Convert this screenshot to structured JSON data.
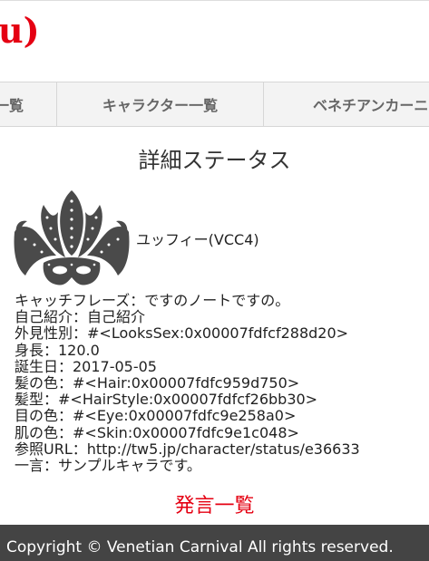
{
  "header": {
    "brand_fragment": "u)"
  },
  "nav": {
    "items": [
      {
        "label": "一覧"
      },
      {
        "label": "キャラクター一覧"
      },
      {
        "label": "ベネチアンカーニ"
      }
    ]
  },
  "page": {
    "title": "詳細ステータス"
  },
  "character": {
    "avatar_icon": "venetian-mask-icon",
    "name": "ユッフィー(VCC4)",
    "profile": [
      "キャッチフレーズ：ですのノートですの。",
      "自己紹介：自己紹介",
      "外見性別：#<LooksSex:0x00007fdfcf288d20>",
      "身長：120.0",
      "誕生日：2017-05-05",
      "髪の色：#<Hair:0x00007fdfc959d750>",
      "髪型：#<HairStyle:0x00007fdfcf26bb30>",
      "目の色：#<Eye:0x00007fdfc9e258a0>",
      "肌の色：#<Skin:0x00007fdfc9e1c048>",
      "参照URL：http://tw5.jp/character/status/e36633",
      "一言：サンプルキャラです。"
    ]
  },
  "posts_link": {
    "label": "発言一覧"
  },
  "footer": {
    "copyright": "Copyright © Venetian Carnival All rights reserved."
  },
  "colors": {
    "accent": "#e50012",
    "footer_bg": "#444444",
    "nav_bg": "#f3f3f3",
    "mask": "#4a4a4a"
  }
}
